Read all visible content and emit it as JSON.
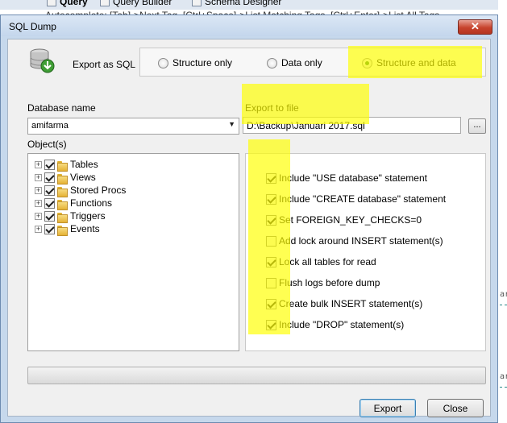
{
  "background": {
    "tabs": [
      "Query",
      "Query Builder",
      "Schema Designer"
    ],
    "hint_text": "Autocomplete: [Tab]->Next Tag. [Ctrl+Space]->List Matching Tags. [Ctrl+Enter]->List All Tags.",
    "code_fragment": "ar"
  },
  "dialog": {
    "title": "SQL Dump",
    "close_glyph": "✕",
    "export_as_label": "Export as SQL",
    "export_options": [
      {
        "label": "Structure only",
        "selected": false
      },
      {
        "label": "Data only",
        "selected": false
      },
      {
        "label": "Structure and data",
        "selected": true
      }
    ],
    "database_label": "Database name",
    "database_value": "amifarma",
    "export_file_label": "Export to file",
    "export_file_value": "D:\\Backup\\Januari 2017.sql",
    "browse_label": "...",
    "objects_label": "Object(s)",
    "objects": [
      {
        "label": "Tables",
        "checked": true
      },
      {
        "label": "Views",
        "checked": true
      },
      {
        "label": "Stored Procs",
        "checked": true
      },
      {
        "label": "Functions",
        "checked": true
      },
      {
        "label": "Triggers",
        "checked": true
      },
      {
        "label": "Events",
        "checked": true
      }
    ],
    "options": [
      {
        "label": "Include \"USE database\" statement",
        "checked": true
      },
      {
        "label": "Include \"CREATE database\" statement",
        "checked": true
      },
      {
        "label": "Set FOREIGN_KEY_CHECKS=0",
        "checked": true
      },
      {
        "label": "Add lock around INSERT statement(s)",
        "checked": false
      },
      {
        "label": "Lock all tables for read",
        "checked": true
      },
      {
        "label": "Flush logs before dump",
        "checked": false
      },
      {
        "label": "Create bulk INSERT statement(s)",
        "checked": true
      },
      {
        "label": "Include \"DROP\" statement(s)",
        "checked": true
      }
    ],
    "progress": 0,
    "export_button": "Export",
    "close_button": "Close"
  },
  "colors": {
    "highlight": "#ffff00",
    "titlebar": "#c4d6ec",
    "close_button": "#c7432d"
  }
}
